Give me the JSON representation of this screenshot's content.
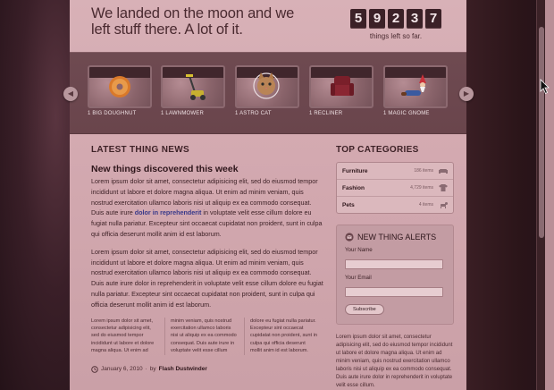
{
  "header": {
    "tagline": "We landed on the moon and we left stuff there. A lot of it.",
    "counter_digits": [
      "5",
      "9",
      "2",
      "3",
      "7"
    ],
    "counter_label": "things left so far."
  },
  "carousel": {
    "items": [
      {
        "label": "1 BIG DOUGHNUT",
        "icon": "doughnut-icon"
      },
      {
        "label": "1 LAWNMOWER",
        "icon": "lawnmower-icon"
      },
      {
        "label": "1 ASTRO CAT",
        "icon": "cat-icon"
      },
      {
        "label": "1 RECLINER",
        "icon": "recliner-icon"
      },
      {
        "label": "1 MAGIC GNOME",
        "icon": "gnome-icon"
      }
    ]
  },
  "news": {
    "section_title": "LATEST THING NEWS",
    "article_title": "New things discovered this week",
    "para1_before": "Lorem ipsum dolor sit amet, consectetur adipisicing elit, sed do eiusmod tempor incididunt ut labore et dolore magna aliqua. Ut enim ad minim veniam, quis nostrud exercitation ullamco laboris nisi ut aliquip ex ea commodo consequat. Duis aute irure ",
    "para1_link": "dolor in reprehenderit",
    "para1_after": " in voluptate velit esse cillum dolore eu fugiat nulla pariatur. Excepteur sint occaecat cupidatat non proident, sunt in culpa qui officia deserunt mollit anim id est laborum.",
    "para2": "Lorem ipsum dolor sit amet, consectetur adipisicing elit, sed do eiusmod tempor incididunt ut labore et dolore magna aliqua. Ut enim ad minim veniam, quis nostrud exercitation ullamco laboris nisi ut aliquip ex ea commodo consequat. Duis aute irure dolor in reprehenderit in voluptate velit esse cillum dolore eu fugiat nulla pariatur. Excepteur sint occaecat cupidatat non proident, sunt in culpa qui officia deserunt mollit anim id est laborum.",
    "columns": [
      "Lorem ipsum dolor sit amet, consectetur adipisicing elit, sed do eiusmod tempor incididunt ut labore et dolore magna aliqua. Ut enim ad",
      "minim veniam, quis nostrud exercitation ullamco laboris nisi ut aliquip ex ea commodo consequat. Duis aute irure in voluptate velit esse cillum",
      "dolore eu fugiat nulla pariatur. Excepteur sint occaecat cupidatat non proident, sunt in culpa qui officia deserunt mollit anim id est laborum."
    ],
    "date": "January 6, 2010",
    "by": "by",
    "author": "Flash Dustwinder"
  },
  "sidebar": {
    "categories_title": "TOP CATEGORIES",
    "categories": [
      {
        "name": "Furniture",
        "count": "186 items",
        "icon": "sofa-icon"
      },
      {
        "name": "Fashion",
        "count": "4,729 items",
        "icon": "shirt-icon"
      },
      {
        "name": "Pets",
        "count": "4 items",
        "icon": "pet-icon"
      }
    ],
    "alerts_title": "NEW THING ALERTS",
    "name_label": "Your Name",
    "email_label": "Your Email",
    "subscribe_label": "Subscribe",
    "note": "Lorem ipsum dolor sit amet, consectetur adipisicing elit, sed do eiusmod tempor incididunt ut labore et dolore magna aliqua. Ut enim ad minim veniam, quis nostrud exercitation ullamco laboris nisi ut aliquip ex ea commodo consequat. Duis aute irure dolor in reprehenderit in voluptate velit esse cillum."
  },
  "colors": {
    "page_tint": "#d3a9b0",
    "dark": "#3b2127",
    "accent_link": "#3a3a8a"
  }
}
